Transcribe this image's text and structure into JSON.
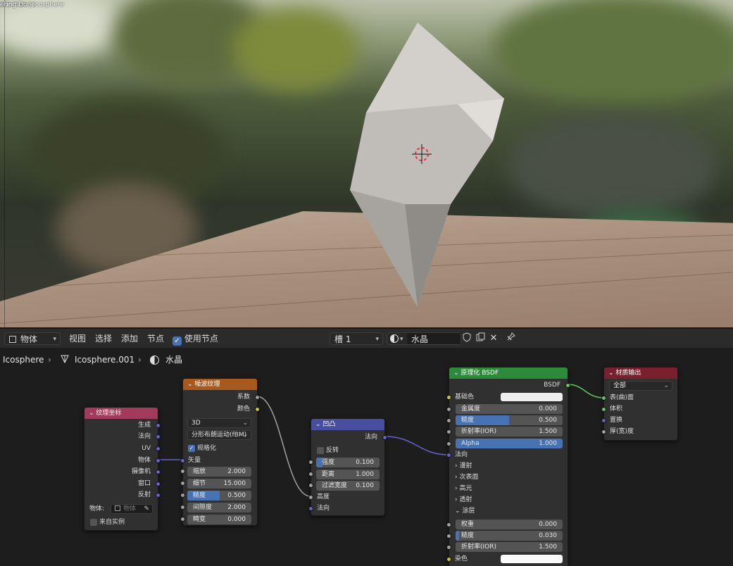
{
  "viewport": {
    "header_line1": "ollection | Icosphere",
    "header_line2": "ering Done"
  },
  "toolbar": {
    "mode": "物体",
    "menu_view": "视图",
    "menu_select": "选择",
    "menu_add": "添加",
    "menu_node": "节点",
    "use_nodes_label": "使用节点",
    "slot": "槽 1",
    "material_name": "水晶"
  },
  "breadcrumb": {
    "object": "Icosphere",
    "mesh": "Icosphere.001",
    "material": "水晶"
  },
  "nodes": {
    "texcoord": {
      "title": "纹理坐标",
      "outputs": [
        "生成",
        "法向",
        "UV",
        "物体",
        "摄像机",
        "窗口",
        "反射"
      ],
      "object_label": "物体:",
      "object_placeholder": "物体",
      "from_instancer": "来自实例",
      "color": "#a23a5b"
    },
    "noise": {
      "title": "噪波纹理",
      "out_fac": "系数",
      "out_color": "颜色",
      "dimensions": "3D",
      "type": "分形布朗运动(fBM)",
      "normalize": "规格化",
      "vector_label": "矢量",
      "fields": [
        {
          "label": "缩放",
          "value": "2.000"
        },
        {
          "label": "细节",
          "value": "15.000"
        },
        {
          "label": "糙度",
          "value": "0.500",
          "fill": 0.5
        },
        {
          "label": "间隙度",
          "value": "2.000"
        },
        {
          "label": "畸变",
          "value": "0.000"
        }
      ],
      "color": "#a8591d"
    },
    "bump": {
      "title": "凹凸",
      "out_normal": "法向",
      "invert": "反转",
      "fields": [
        {
          "label": "强度",
          "value": "0.100",
          "fill": 0.1
        },
        {
          "label": "距离",
          "value": "1.000"
        },
        {
          "label": "过滤宽度",
          "value": "0.100"
        }
      ],
      "in_height": "高度",
      "in_normal": "法向",
      "color": "#4a4ea0"
    },
    "bsdf": {
      "title": "原理化 BSDF",
      "out": "BSDF",
      "base_color": "基础色",
      "fields_top": [
        {
          "label": "金属度",
          "value": "0.000"
        },
        {
          "label": "糙度",
          "value": "0.500",
          "fill": 0.5
        },
        {
          "label": "折射率(IOR)",
          "value": "1.500"
        },
        {
          "label": "Alpha",
          "value": "1.000",
          "fill": 1.0
        }
      ],
      "normal": "法向",
      "panels": [
        "漫射",
        "次表面",
        "高光",
        "透射"
      ],
      "coat_panel": "涂层",
      "fields_coat": [
        {
          "label": "权重",
          "value": "0.000"
        },
        {
          "label": "糙度",
          "value": "0.030",
          "fill": 0.03
        },
        {
          "label": "折射率(IOR)",
          "value": "1.500"
        }
      ],
      "tint": "染色",
      "color": "#2c8a3a"
    },
    "output": {
      "title": "材质输出",
      "target": "全部",
      "inputs": [
        "表(曲)面",
        "体积",
        "置换",
        "厚(宽)度"
      ],
      "color": "#7a1f2c"
    }
  }
}
